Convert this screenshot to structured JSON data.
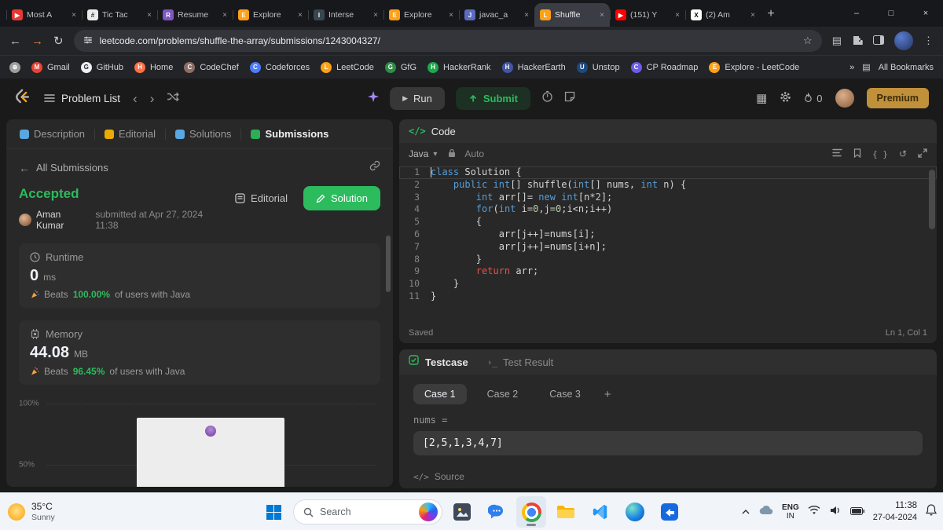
{
  "browser": {
    "tabs": [
      {
        "title": "Most A",
        "bg": "#e53935",
        "fg": "#ffffff",
        "glyph": "▶"
      },
      {
        "title": "Tic Tac",
        "bg": "#ececec",
        "fg": "#333333",
        "glyph": "#"
      },
      {
        "title": "Resume",
        "bg": "#7e57c2",
        "fg": "#ffffff",
        "glyph": "R"
      },
      {
        "title": "Explore",
        "bg": "#ffa116",
        "fg": "#ffffff",
        "glyph": "E"
      },
      {
        "title": "Interse",
        "bg": "#37474f",
        "fg": "#ffffff",
        "glyph": "I"
      },
      {
        "title": "Explore",
        "bg": "#ffa116",
        "fg": "#ffffff",
        "glyph": "E"
      },
      {
        "title": "javac_a",
        "bg": "#5c6bc0",
        "fg": "#ffffff",
        "glyph": "J"
      },
      {
        "title": "Shuffle",
        "bg": "#ffa116",
        "fg": "#ffffff",
        "glyph": "L",
        "active": true
      },
      {
        "title": "(151) Y",
        "bg": "#ff0000",
        "fg": "#ffffff",
        "glyph": "▶"
      },
      {
        "title": "(2) Am",
        "bg": "#ffffff",
        "fg": "#000000",
        "glyph": "X"
      }
    ],
    "new_tab_glyph": "+",
    "url": "leetcode.com/problems/shuffle-the-array/submissions/1243004327/",
    "bookmarks": [
      {
        "label": "",
        "bg": "#9e9e9e",
        "fg": "#ffffff",
        "glyph": "⊕"
      },
      {
        "label": "Gmail",
        "bg": "#ea4335",
        "fg": "#ffffff",
        "glyph": "M"
      },
      {
        "label": "GitHub",
        "bg": "#f0f0f0",
        "fg": "#24292e",
        "glyph": "G"
      },
      {
        "label": "Home",
        "bg": "#ff7043",
        "fg": "#ffffff",
        "glyph": "H"
      },
      {
        "label": "CodeChef",
        "bg": "#8d6e63",
        "fg": "#ffffff",
        "glyph": "C"
      },
      {
        "label": "Codeforces",
        "bg": "#4a7dff",
        "fg": "#ffffff",
        "glyph": "C"
      },
      {
        "label": "LeetCode",
        "bg": "#ffa116",
        "fg": "#ffffff",
        "glyph": "L"
      },
      {
        "label": "GfG",
        "bg": "#2f8d46",
        "fg": "#ffffff",
        "glyph": "G"
      },
      {
        "label": "HackerRank",
        "bg": "#1ba94c",
        "fg": "#ffffff",
        "glyph": "H"
      },
      {
        "label": "HackerEarth",
        "bg": "#4255a4",
        "fg": "#ffffff",
        "glyph": "H"
      },
      {
        "label": "Unstop",
        "bg": "#1c4980",
        "fg": "#ffffff",
        "glyph": "U"
      },
      {
        "label": "CP Roadmap",
        "bg": "#6c5ce7",
        "fg": "#ffffff",
        "glyph": "C"
      },
      {
        "label": "Explore - LeetCode",
        "bg": "#ffa116",
        "fg": "#ffffff",
        "glyph": "E"
      }
    ],
    "overflow_chevron": "»",
    "all_bookmarks": "All Bookmarks"
  },
  "lc": {
    "problem_list": "Problem List",
    "run": "Run",
    "submit": "Submit",
    "streak": "0",
    "premium": "Premium"
  },
  "detail": {
    "tabs": [
      {
        "label": "Description",
        "color": "#5db5f5"
      },
      {
        "label": "Editorial",
        "color": "#ffb800"
      },
      {
        "label": "Solutions",
        "color": "#5db5f5"
      },
      {
        "label": "Submissions",
        "color": "#2cbb5d",
        "active": true
      }
    ],
    "back": "All Submissions",
    "status": "Accepted",
    "author": "Aman Kumar",
    "submitted": "submitted at Apr 27, 2024 11:38",
    "editorial_btn": "Editorial",
    "solution_btn": "Solution",
    "runtime": {
      "label": "Runtime",
      "value": "0",
      "unit": "ms",
      "beats_label": "Beats",
      "beats_value": "100.00%",
      "beats_suffix": "of users with Java"
    },
    "memory": {
      "label": "Memory",
      "value": "44.08",
      "unit": "MB",
      "beats_label": "Beats",
      "beats_value": "96.45%",
      "beats_suffix": "of users with Java"
    },
    "chart_labels": {
      "top": "100%",
      "mid": "50%"
    }
  },
  "editor": {
    "icon": "</>",
    "title": "Code",
    "language": "Java",
    "auto_label": "Auto",
    "saved": "Saved",
    "cursor_pos": "Ln 1, Col 1",
    "lines": [
      [
        {
          "t": "class",
          "c": "kw"
        },
        {
          "t": " Solution {",
          "c": "pl"
        }
      ],
      [
        {
          "t": "    ",
          "c": "pl"
        },
        {
          "t": "public",
          "c": "kw"
        },
        {
          "t": " ",
          "c": "pl"
        },
        {
          "t": "int",
          "c": "kw"
        },
        {
          "t": "[] shuffle(",
          "c": "pl"
        },
        {
          "t": "int",
          "c": "kw"
        },
        {
          "t": "[] nums, ",
          "c": "pl"
        },
        {
          "t": "int",
          "c": "kw"
        },
        {
          "t": " n) {",
          "c": "pl"
        }
      ],
      [
        {
          "t": "        ",
          "c": "pl"
        },
        {
          "t": "int",
          "c": "kw"
        },
        {
          "t": " arr[]= ",
          "c": "pl"
        },
        {
          "t": "new",
          "c": "kw"
        },
        {
          "t": " ",
          "c": "pl"
        },
        {
          "t": "int",
          "c": "kw"
        },
        {
          "t": "[n*",
          "c": "pl"
        },
        {
          "t": "2",
          "c": "num"
        },
        {
          "t": "];",
          "c": "pl"
        }
      ],
      [
        {
          "t": "        ",
          "c": "pl"
        },
        {
          "t": "for",
          "c": "kw"
        },
        {
          "t": "(",
          "c": "pl"
        },
        {
          "t": "int",
          "c": "kw"
        },
        {
          "t": " i=",
          "c": "pl"
        },
        {
          "t": "0",
          "c": "num"
        },
        {
          "t": ",j=",
          "c": "pl"
        },
        {
          "t": "0",
          "c": "num"
        },
        {
          "t": ";i<n;i++)",
          "c": "pl"
        }
      ],
      [
        {
          "t": "        {",
          "c": "pl"
        }
      ],
      [
        {
          "t": "            arr[j++]=nums[i];",
          "c": "pl"
        }
      ],
      [
        {
          "t": "            arr[j++]=nums[i+n];",
          "c": "pl"
        }
      ],
      [
        {
          "t": "        }",
          "c": "pl"
        }
      ],
      [
        {
          "t": "        ",
          "c": "pl"
        },
        {
          "t": "return",
          "c": "ret"
        },
        {
          "t": " arr;",
          "c": "pl"
        }
      ],
      [
        {
          "t": "    }",
          "c": "pl"
        }
      ],
      [
        {
          "t": "}",
          "c": "pl"
        }
      ]
    ]
  },
  "testcase": {
    "tab_label": "Testcase",
    "result_icon": "›_",
    "result_label": "Test Result",
    "cases": [
      "Case 1",
      "Case 2",
      "Case 3"
    ],
    "add": "+",
    "param_label": "nums =",
    "param_value": "[2,5,1,3,4,7]",
    "source_icon": "</>",
    "source_label": "Source"
  },
  "taskbar": {
    "temperature": "35°C",
    "condition": "Sunny",
    "search_placeholder": "Search",
    "lang_primary": "ENG",
    "lang_secondary": "IN",
    "time": "11:38",
    "date": "27-04-2024"
  }
}
